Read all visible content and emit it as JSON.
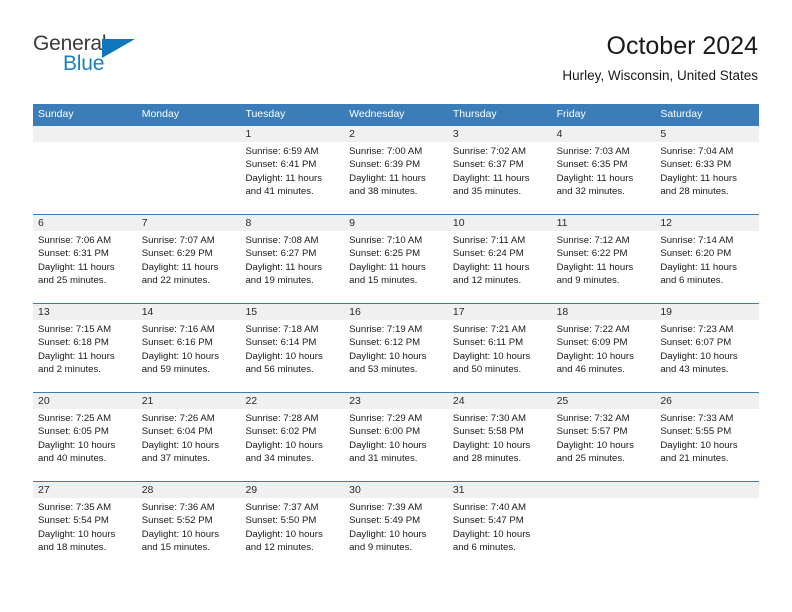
{
  "brand": {
    "name_part1": "General",
    "name_part2": "Blue",
    "triangle_icon": "triangle-flag-icon",
    "colors": {
      "general": "#3b3b3b",
      "blue": "#1b7fc4",
      "triangle": "#0f76bc"
    }
  },
  "header": {
    "month_title": "October 2024",
    "location": "Hurley, Wisconsin, United States"
  },
  "theme": {
    "header_blue": "#3a7db9",
    "date_band_gray": "#f0f0f0",
    "text": "#1a1a1a"
  },
  "weekdays": [
    "Sunday",
    "Monday",
    "Tuesday",
    "Wednesday",
    "Thursday",
    "Friday",
    "Saturday"
  ],
  "labels": {
    "sunrise_prefix": "Sunrise:",
    "sunset_prefix": "Sunset:",
    "daylight_prefix": "Daylight:"
  },
  "weeks": [
    [
      {
        "day": "",
        "empty": true,
        "line1": "",
        "line2": "",
        "line3": "",
        "line4": ""
      },
      {
        "day": "",
        "empty": true,
        "line1": "",
        "line2": "",
        "line3": "",
        "line4": ""
      },
      {
        "day": "1",
        "empty": false,
        "line1": "Sunrise: 6:59 AM",
        "line2": "Sunset: 6:41 PM",
        "line3": "Daylight: 11 hours",
        "line4": "and 41 minutes."
      },
      {
        "day": "2",
        "empty": false,
        "line1": "Sunrise: 7:00 AM",
        "line2": "Sunset: 6:39 PM",
        "line3": "Daylight: 11 hours",
        "line4": "and 38 minutes."
      },
      {
        "day": "3",
        "empty": false,
        "line1": "Sunrise: 7:02 AM",
        "line2": "Sunset: 6:37 PM",
        "line3": "Daylight: 11 hours",
        "line4": "and 35 minutes."
      },
      {
        "day": "4",
        "empty": false,
        "line1": "Sunrise: 7:03 AM",
        "line2": "Sunset: 6:35 PM",
        "line3": "Daylight: 11 hours",
        "line4": "and 32 minutes."
      },
      {
        "day": "5",
        "empty": false,
        "line1": "Sunrise: 7:04 AM",
        "line2": "Sunset: 6:33 PM",
        "line3": "Daylight: 11 hours",
        "line4": "and 28 minutes."
      }
    ],
    [
      {
        "day": "6",
        "empty": false,
        "line1": "Sunrise: 7:06 AM",
        "line2": "Sunset: 6:31 PM",
        "line3": "Daylight: 11 hours",
        "line4": "and 25 minutes."
      },
      {
        "day": "7",
        "empty": false,
        "line1": "Sunrise: 7:07 AM",
        "line2": "Sunset: 6:29 PM",
        "line3": "Daylight: 11 hours",
        "line4": "and 22 minutes."
      },
      {
        "day": "8",
        "empty": false,
        "line1": "Sunrise: 7:08 AM",
        "line2": "Sunset: 6:27 PM",
        "line3": "Daylight: 11 hours",
        "line4": "and 19 minutes."
      },
      {
        "day": "9",
        "empty": false,
        "line1": "Sunrise: 7:10 AM",
        "line2": "Sunset: 6:25 PM",
        "line3": "Daylight: 11 hours",
        "line4": "and 15 minutes."
      },
      {
        "day": "10",
        "empty": false,
        "line1": "Sunrise: 7:11 AM",
        "line2": "Sunset: 6:24 PM",
        "line3": "Daylight: 11 hours",
        "line4": "and 12 minutes."
      },
      {
        "day": "11",
        "empty": false,
        "line1": "Sunrise: 7:12 AM",
        "line2": "Sunset: 6:22 PM",
        "line3": "Daylight: 11 hours",
        "line4": "and 9 minutes."
      },
      {
        "day": "12",
        "empty": false,
        "line1": "Sunrise: 7:14 AM",
        "line2": "Sunset: 6:20 PM",
        "line3": "Daylight: 11 hours",
        "line4": "and 6 minutes."
      }
    ],
    [
      {
        "day": "13",
        "empty": false,
        "line1": "Sunrise: 7:15 AM",
        "line2": "Sunset: 6:18 PM",
        "line3": "Daylight: 11 hours",
        "line4": "and 2 minutes."
      },
      {
        "day": "14",
        "empty": false,
        "line1": "Sunrise: 7:16 AM",
        "line2": "Sunset: 6:16 PM",
        "line3": "Daylight: 10 hours",
        "line4": "and 59 minutes."
      },
      {
        "day": "15",
        "empty": false,
        "line1": "Sunrise: 7:18 AM",
        "line2": "Sunset: 6:14 PM",
        "line3": "Daylight: 10 hours",
        "line4": "and 56 minutes."
      },
      {
        "day": "16",
        "empty": false,
        "line1": "Sunrise: 7:19 AM",
        "line2": "Sunset: 6:12 PM",
        "line3": "Daylight: 10 hours",
        "line4": "and 53 minutes."
      },
      {
        "day": "17",
        "empty": false,
        "line1": "Sunrise: 7:21 AM",
        "line2": "Sunset: 6:11 PM",
        "line3": "Daylight: 10 hours",
        "line4": "and 50 minutes."
      },
      {
        "day": "18",
        "empty": false,
        "line1": "Sunrise: 7:22 AM",
        "line2": "Sunset: 6:09 PM",
        "line3": "Daylight: 10 hours",
        "line4": "and 46 minutes."
      },
      {
        "day": "19",
        "empty": false,
        "line1": "Sunrise: 7:23 AM",
        "line2": "Sunset: 6:07 PM",
        "line3": "Daylight: 10 hours",
        "line4": "and 43 minutes."
      }
    ],
    [
      {
        "day": "20",
        "empty": false,
        "line1": "Sunrise: 7:25 AM",
        "line2": "Sunset: 6:05 PM",
        "line3": "Daylight: 10 hours",
        "line4": "and 40 minutes."
      },
      {
        "day": "21",
        "empty": false,
        "line1": "Sunrise: 7:26 AM",
        "line2": "Sunset: 6:04 PM",
        "line3": "Daylight: 10 hours",
        "line4": "and 37 minutes."
      },
      {
        "day": "22",
        "empty": false,
        "line1": "Sunrise: 7:28 AM",
        "line2": "Sunset: 6:02 PM",
        "line3": "Daylight: 10 hours",
        "line4": "and 34 minutes."
      },
      {
        "day": "23",
        "empty": false,
        "line1": "Sunrise: 7:29 AM",
        "line2": "Sunset: 6:00 PM",
        "line3": "Daylight: 10 hours",
        "line4": "and 31 minutes."
      },
      {
        "day": "24",
        "empty": false,
        "line1": "Sunrise: 7:30 AM",
        "line2": "Sunset: 5:58 PM",
        "line3": "Daylight: 10 hours",
        "line4": "and 28 minutes."
      },
      {
        "day": "25",
        "empty": false,
        "line1": "Sunrise: 7:32 AM",
        "line2": "Sunset: 5:57 PM",
        "line3": "Daylight: 10 hours",
        "line4": "and 25 minutes."
      },
      {
        "day": "26",
        "empty": false,
        "line1": "Sunrise: 7:33 AM",
        "line2": "Sunset: 5:55 PM",
        "line3": "Daylight: 10 hours",
        "line4": "and 21 minutes."
      }
    ],
    [
      {
        "day": "27",
        "empty": false,
        "line1": "Sunrise: 7:35 AM",
        "line2": "Sunset: 5:54 PM",
        "line3": "Daylight: 10 hours",
        "line4": "and 18 minutes."
      },
      {
        "day": "28",
        "empty": false,
        "line1": "Sunrise: 7:36 AM",
        "line2": "Sunset: 5:52 PM",
        "line3": "Daylight: 10 hours",
        "line4": "and 15 minutes."
      },
      {
        "day": "29",
        "empty": false,
        "line1": "Sunrise: 7:37 AM",
        "line2": "Sunset: 5:50 PM",
        "line3": "Daylight: 10 hours",
        "line4": "and 12 minutes."
      },
      {
        "day": "30",
        "empty": false,
        "line1": "Sunrise: 7:39 AM",
        "line2": "Sunset: 5:49 PM",
        "line3": "Daylight: 10 hours",
        "line4": "and 9 minutes."
      },
      {
        "day": "31",
        "empty": false,
        "line1": "Sunrise: 7:40 AM",
        "line2": "Sunset: 5:47 PM",
        "line3": "Daylight: 10 hours",
        "line4": "and 6 minutes."
      },
      {
        "day": "",
        "empty": true,
        "line1": "",
        "line2": "",
        "line3": "",
        "line4": ""
      },
      {
        "day": "",
        "empty": true,
        "line1": "",
        "line2": "",
        "line3": "",
        "line4": ""
      }
    ]
  ]
}
